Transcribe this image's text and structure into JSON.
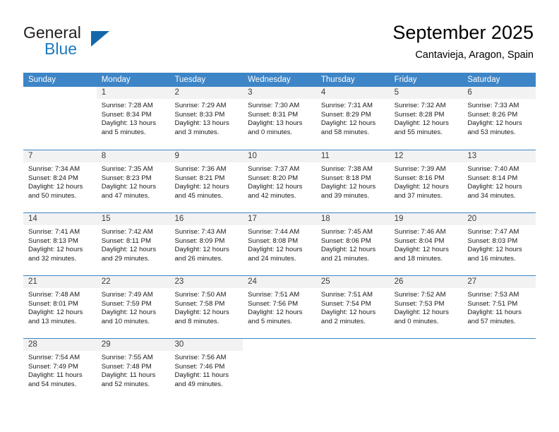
{
  "logo": {
    "word_general": "General",
    "word_blue": "Blue",
    "triangle_icon": "logo-triangle-icon"
  },
  "header": {
    "title": "September 2025",
    "subtitle": "Cantavieja, Aragon, Spain"
  },
  "colors": {
    "header_blue": "#3d85c6",
    "daynum_gray": "#f2f2f2",
    "logo_blue": "#1e7bc0",
    "text_black": "#000000"
  },
  "labels": {
    "sunrise_prefix": "Sunrise:",
    "sunset_prefix": "Sunset:",
    "daylight_prefix": "Daylight:"
  },
  "weekdays": [
    "Sunday",
    "Monday",
    "Tuesday",
    "Wednesday",
    "Thursday",
    "Friday",
    "Saturday"
  ],
  "weeks": [
    [
      {
        "day": "",
        "sunrise": "",
        "sunset": "",
        "daylight": "",
        "empty": true
      },
      {
        "day": "1",
        "sunrise": "Sunrise: 7:28 AM",
        "sunset": "Sunset: 8:34 PM",
        "daylight": "Daylight: 13 hours and 5 minutes."
      },
      {
        "day": "2",
        "sunrise": "Sunrise: 7:29 AM",
        "sunset": "Sunset: 8:33 PM",
        "daylight": "Daylight: 13 hours and 3 minutes."
      },
      {
        "day": "3",
        "sunrise": "Sunrise: 7:30 AM",
        "sunset": "Sunset: 8:31 PM",
        "daylight": "Daylight: 13 hours and 0 minutes."
      },
      {
        "day": "4",
        "sunrise": "Sunrise: 7:31 AM",
        "sunset": "Sunset: 8:29 PM",
        "daylight": "Daylight: 12 hours and 58 minutes."
      },
      {
        "day": "5",
        "sunrise": "Sunrise: 7:32 AM",
        "sunset": "Sunset: 8:28 PM",
        "daylight": "Daylight: 12 hours and 55 minutes."
      },
      {
        "day": "6",
        "sunrise": "Sunrise: 7:33 AM",
        "sunset": "Sunset: 8:26 PM",
        "daylight": "Daylight: 12 hours and 53 minutes."
      }
    ],
    [
      {
        "day": "7",
        "sunrise": "Sunrise: 7:34 AM",
        "sunset": "Sunset: 8:24 PM",
        "daylight": "Daylight: 12 hours and 50 minutes."
      },
      {
        "day": "8",
        "sunrise": "Sunrise: 7:35 AM",
        "sunset": "Sunset: 8:23 PM",
        "daylight": "Daylight: 12 hours and 47 minutes."
      },
      {
        "day": "9",
        "sunrise": "Sunrise: 7:36 AM",
        "sunset": "Sunset: 8:21 PM",
        "daylight": "Daylight: 12 hours and 45 minutes."
      },
      {
        "day": "10",
        "sunrise": "Sunrise: 7:37 AM",
        "sunset": "Sunset: 8:20 PM",
        "daylight": "Daylight: 12 hours and 42 minutes."
      },
      {
        "day": "11",
        "sunrise": "Sunrise: 7:38 AM",
        "sunset": "Sunset: 8:18 PM",
        "daylight": "Daylight: 12 hours and 39 minutes."
      },
      {
        "day": "12",
        "sunrise": "Sunrise: 7:39 AM",
        "sunset": "Sunset: 8:16 PM",
        "daylight": "Daylight: 12 hours and 37 minutes."
      },
      {
        "day": "13",
        "sunrise": "Sunrise: 7:40 AM",
        "sunset": "Sunset: 8:14 PM",
        "daylight": "Daylight: 12 hours and 34 minutes."
      }
    ],
    [
      {
        "day": "14",
        "sunrise": "Sunrise: 7:41 AM",
        "sunset": "Sunset: 8:13 PM",
        "daylight": "Daylight: 12 hours and 32 minutes."
      },
      {
        "day": "15",
        "sunrise": "Sunrise: 7:42 AM",
        "sunset": "Sunset: 8:11 PM",
        "daylight": "Daylight: 12 hours and 29 minutes."
      },
      {
        "day": "16",
        "sunrise": "Sunrise: 7:43 AM",
        "sunset": "Sunset: 8:09 PM",
        "daylight": "Daylight: 12 hours and 26 minutes."
      },
      {
        "day": "17",
        "sunrise": "Sunrise: 7:44 AM",
        "sunset": "Sunset: 8:08 PM",
        "daylight": "Daylight: 12 hours and 24 minutes."
      },
      {
        "day": "18",
        "sunrise": "Sunrise: 7:45 AM",
        "sunset": "Sunset: 8:06 PM",
        "daylight": "Daylight: 12 hours and 21 minutes."
      },
      {
        "day": "19",
        "sunrise": "Sunrise: 7:46 AM",
        "sunset": "Sunset: 8:04 PM",
        "daylight": "Daylight: 12 hours and 18 minutes."
      },
      {
        "day": "20",
        "sunrise": "Sunrise: 7:47 AM",
        "sunset": "Sunset: 8:03 PM",
        "daylight": "Daylight: 12 hours and 16 minutes."
      }
    ],
    [
      {
        "day": "21",
        "sunrise": "Sunrise: 7:48 AM",
        "sunset": "Sunset: 8:01 PM",
        "daylight": "Daylight: 12 hours and 13 minutes."
      },
      {
        "day": "22",
        "sunrise": "Sunrise: 7:49 AM",
        "sunset": "Sunset: 7:59 PM",
        "daylight": "Daylight: 12 hours and 10 minutes."
      },
      {
        "day": "23",
        "sunrise": "Sunrise: 7:50 AM",
        "sunset": "Sunset: 7:58 PM",
        "daylight": "Daylight: 12 hours and 8 minutes."
      },
      {
        "day": "24",
        "sunrise": "Sunrise: 7:51 AM",
        "sunset": "Sunset: 7:56 PM",
        "daylight": "Daylight: 12 hours and 5 minutes."
      },
      {
        "day": "25",
        "sunrise": "Sunrise: 7:51 AM",
        "sunset": "Sunset: 7:54 PM",
        "daylight": "Daylight: 12 hours and 2 minutes."
      },
      {
        "day": "26",
        "sunrise": "Sunrise: 7:52 AM",
        "sunset": "Sunset: 7:53 PM",
        "daylight": "Daylight: 12 hours and 0 minutes."
      },
      {
        "day": "27",
        "sunrise": "Sunrise: 7:53 AM",
        "sunset": "Sunset: 7:51 PM",
        "daylight": "Daylight: 11 hours and 57 minutes."
      }
    ],
    [
      {
        "day": "28",
        "sunrise": "Sunrise: 7:54 AM",
        "sunset": "Sunset: 7:49 PM",
        "daylight": "Daylight: 11 hours and 54 minutes."
      },
      {
        "day": "29",
        "sunrise": "Sunrise: 7:55 AM",
        "sunset": "Sunset: 7:48 PM",
        "daylight": "Daylight: 11 hours and 52 minutes."
      },
      {
        "day": "30",
        "sunrise": "Sunrise: 7:56 AM",
        "sunset": "Sunset: 7:46 PM",
        "daylight": "Daylight: 11 hours and 49 minutes."
      },
      {
        "day": "",
        "sunrise": "",
        "sunset": "",
        "daylight": "",
        "empty": true
      },
      {
        "day": "",
        "sunrise": "",
        "sunset": "",
        "daylight": "",
        "empty": true
      },
      {
        "day": "",
        "sunrise": "",
        "sunset": "",
        "daylight": "",
        "empty": true
      },
      {
        "day": "",
        "sunrise": "",
        "sunset": "",
        "daylight": "",
        "empty": true
      }
    ]
  ]
}
